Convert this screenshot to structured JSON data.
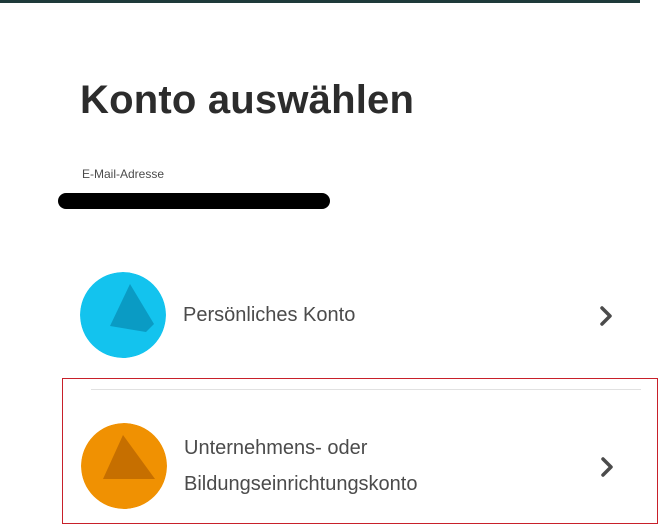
{
  "page": {
    "title": "Konto auswählen",
    "email_label": "E-Mail-Adresse"
  },
  "accounts": [
    {
      "label": "Persönliches Konto",
      "icon": "personal-account-icon",
      "color": "#13c3ee",
      "shade": "#0a9bc4"
    },
    {
      "label": "Unternehmens- oder Bildungseinrichtungskonto",
      "icon": "business-account-icon",
      "color": "#f09102",
      "shade": "#c66f00",
      "highlighted": true
    }
  ],
  "colors": {
    "highlight_border": "#c8202a",
    "top_border": "#1e3a3a"
  }
}
